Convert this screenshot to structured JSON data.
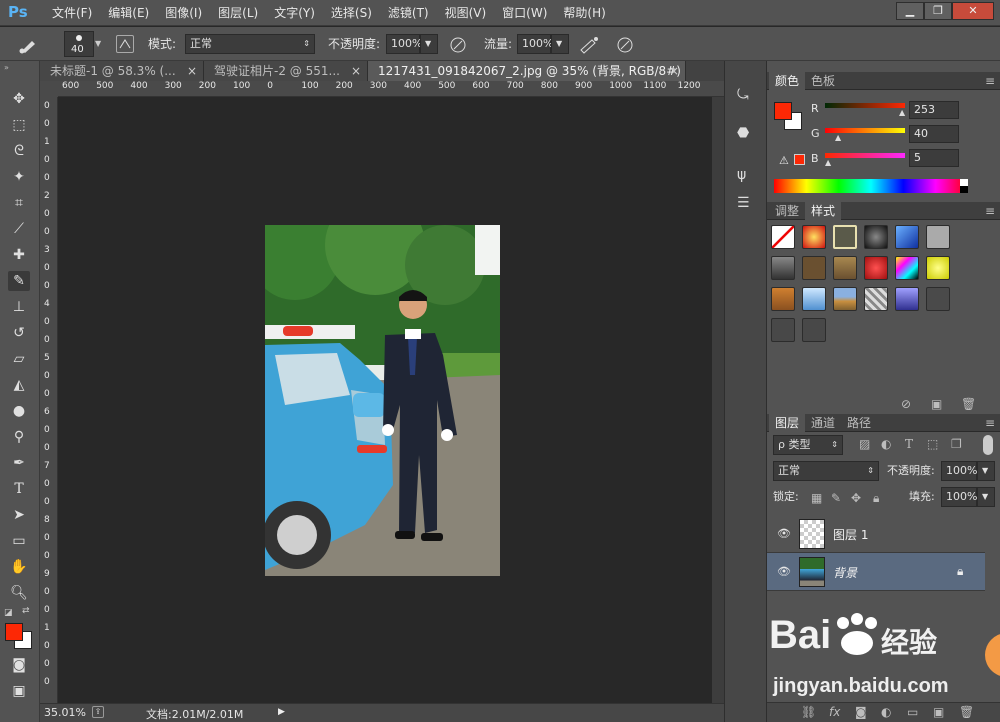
{
  "app": {
    "logo": "Ps"
  },
  "menu": [
    "文件(F)",
    "编辑(E)",
    "图像(I)",
    "图层(L)",
    "文字(Y)",
    "选择(S)",
    "滤镜(T)",
    "视图(V)",
    "窗口(W)",
    "帮助(H)"
  ],
  "window_buttons": {
    "min": "▁",
    "restore": "❐",
    "close": "✕"
  },
  "options": {
    "brush_size": "40",
    "mode_label": "模式:",
    "mode_value": "正常",
    "opacity_label": "不透明度:",
    "opacity_value": "100%",
    "flow_label": "流量:",
    "flow_value": "100%"
  },
  "tabs": [
    {
      "label": "未标题-1 @ 58.3% (...",
      "close": "×"
    },
    {
      "label": "驾驶证相片-2 @ 551...",
      "close": "×"
    },
    {
      "label": "1217431_091842067_2.jpg @ 35% (背景, RGB/8#) *",
      "close": "×"
    }
  ],
  "ruler_h": [
    "600",
    "500",
    "400",
    "300",
    "200",
    "100",
    "0",
    "100",
    "200",
    "300",
    "400",
    "500",
    "600",
    "700",
    "800",
    "900",
    "1000",
    "1100",
    "1200"
  ],
  "ruler_v": [
    "0",
    "0",
    "1",
    "0",
    "0",
    "2",
    "0",
    "0",
    "3",
    "0",
    "0",
    "4",
    "0",
    "0",
    "5",
    "0",
    "0",
    "6",
    "0",
    "0",
    "7",
    "0",
    "0",
    "8",
    "0",
    "0",
    "9",
    "0",
    "0",
    "1",
    "0",
    "0",
    "0"
  ],
  "status": {
    "zoom": "35.01%",
    "doc": "文档:2.01M/2.01M"
  },
  "color_panel": {
    "tabs": [
      "颜色",
      "色板"
    ],
    "fg_color": "#fd2805",
    "r_label": "R",
    "r_value": "253",
    "g_label": "G",
    "g_value": "40",
    "b_label": "B",
    "b_value": "5"
  },
  "styles_panel": {
    "tabs": [
      "调整",
      "样式"
    ]
  },
  "layers_panel": {
    "tabs": [
      "图层",
      "通道",
      "路径"
    ],
    "filter_label": "ρ 类型",
    "blend_mode": "正常",
    "opacity_label": "不透明度:",
    "opacity_value": "100%",
    "lock_label": "锁定:",
    "fill_label": "填充:",
    "fill_value": "100%",
    "layers": [
      {
        "name": "图层 1"
      },
      {
        "name": "背景"
      }
    ]
  },
  "watermark": {
    "brand": "Bai",
    "brand2": "经验",
    "url": "jingyan.baidu.com"
  },
  "icons": [
    "move-icon",
    "marquee-icon",
    "lasso-icon",
    "magic-wand-icon",
    "crop-icon",
    "eyedropper-icon",
    "healing-icon",
    "brush-icon",
    "stamp-icon",
    "history-brush-icon",
    "eraser-icon",
    "bucket-icon",
    "blur-icon",
    "dodge-icon",
    "pen-icon",
    "type-icon",
    "path-select-icon",
    "shape-icon",
    "hand-icon",
    "zoom-icon"
  ]
}
